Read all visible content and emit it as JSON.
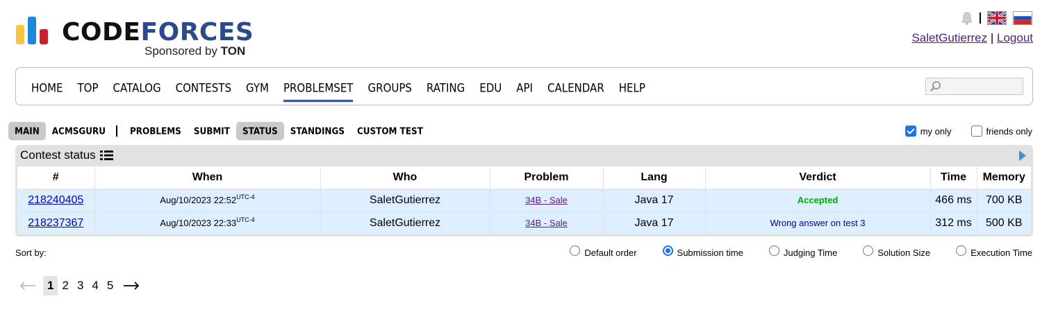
{
  "header": {
    "logo_part1": "CODE",
    "logo_part2": "FORCES",
    "sponsor_text": "Sponsored by",
    "sponsor_name": "TON",
    "user": "SaletGutierrez",
    "separator": "|",
    "logout": "Logout"
  },
  "menu": {
    "items": [
      "HOME",
      "TOP",
      "CATALOG",
      "CONTESTS",
      "GYM",
      "PROBLEMSET",
      "GROUPS",
      "RATING",
      "EDU",
      "API",
      "CALENDAR",
      "HELP"
    ],
    "active": "PROBLEMSET",
    "search_placeholder": ""
  },
  "submenu": {
    "items": [
      "MAIN",
      "ACMSGURU",
      "PROBLEMS",
      "SUBMIT",
      "STATUS",
      "STANDINGS",
      "CUSTOM TEST"
    ],
    "selected": [
      "MAIN",
      "STATUS"
    ]
  },
  "filters": {
    "my_only": "my only",
    "my_only_checked": true,
    "friends_only": "friends only",
    "friends_only_checked": false
  },
  "status": {
    "title": "Contest status",
    "columns": [
      "#",
      "When",
      "Who",
      "Problem",
      "Lang",
      "Verdict",
      "Time",
      "Memory"
    ],
    "rows": [
      {
        "id": "218240405",
        "when": "Aug/10/2023 22:52",
        "tz": "UTC-4",
        "who": "SaletGutierrez",
        "problem": "34B - Sale",
        "lang": "Java 17",
        "verdict": "Accepted",
        "time": "466 ms",
        "memory": "700 KB"
      },
      {
        "id": "218237367",
        "when": "Aug/10/2023 22:33",
        "tz": "UTC-4",
        "who": "SaletGutierrez",
        "problem": "34B - Sale",
        "lang": "Java 17",
        "verdict": "Wrong answer on test 3",
        "time": "312 ms",
        "memory": "500 KB"
      }
    ]
  },
  "sort": {
    "label": "Sort by:",
    "options": [
      "Default order",
      "Submission time",
      "Judging Time",
      "Solution Size",
      "Execution Time"
    ],
    "selected": "Submission time"
  },
  "pager": {
    "pages": [
      "1",
      "2",
      "3",
      "4",
      "5"
    ],
    "current": "1"
  },
  "colors": {
    "accent": "#3b5998",
    "row_bg": "#ddeeff",
    "accepted": "#00aa00",
    "wrong": "#0000aa",
    "link": "#551a8b"
  }
}
